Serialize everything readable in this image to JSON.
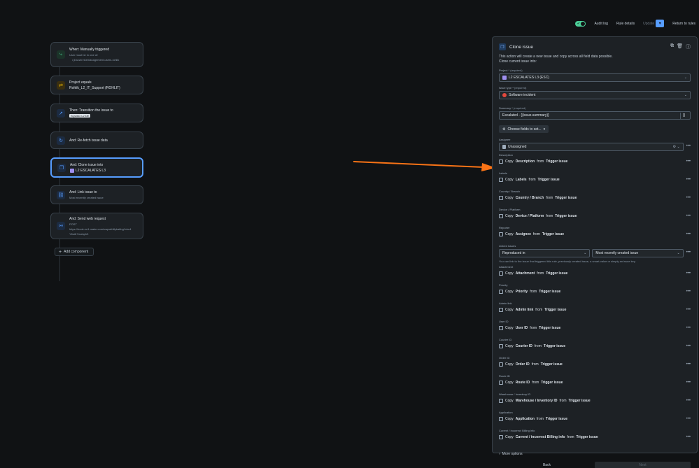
{
  "topbar": {
    "audit_log": "Audit log",
    "rule_details": "Rule details",
    "update": "Update",
    "return": "Return to rules"
  },
  "flow": {
    "nodes": [
      {
        "title": "When: Manually triggered",
        "sub1": "User must be in one of:",
        "sub2": "• jira-servicemanagement-users-rohlik",
        "icon_color": "#4bce97",
        "icon": "trigger-icon"
      },
      {
        "title": "Project equals",
        "sub1": "Rohlik_L2_IT_Support (ROHLIT)",
        "icon_color": "#e2b203",
        "icon": "shuffle-icon"
      },
      {
        "title": "Then: Transition the issue to",
        "tag": "SQUAD L2 DE",
        "icon_color": "#579dff",
        "icon": "transition-icon"
      },
      {
        "title": "And: Re-fetch issue data",
        "icon_color": "#579dff",
        "icon": "refresh-icon"
      },
      {
        "title": "And: Clone issue into",
        "sub1": "L2 ESCALATES L3",
        "icon_color": "#579dff",
        "icon": "clone-icon"
      },
      {
        "title": "And: Link issue to",
        "sub1": "Most recently created issue",
        "icon_color": "#579dff",
        "icon": "link-icon"
      },
      {
        "title": "And: Send web request",
        "sub1": "POST",
        "sub2": "https://hook.eu1.make.com/uwpwth8ybakbg1vku4",
        "sub3": "Y6u8r7mahph3",
        "icon_color": "#579dff",
        "icon": "webhook-icon"
      }
    ],
    "add_component": "Add component"
  },
  "panel": {
    "title": "Clone issue",
    "description": "This action will create a new issue and copy across all field data possible.",
    "description2": "Clone current issue into:",
    "project_label": "Project *",
    "project_req": "(required)",
    "project_value": "L2 ESCALATES L3 (ESC)",
    "issue_type_label": "Issue type *",
    "issue_type_req": "(required)",
    "issue_type_value": "Software incident",
    "summary_label": "Summary *",
    "summary_req": "(required)",
    "summary_value": "Escalated - {{issue.summary}}",
    "choose_fields": "Choose fields to set...",
    "assignee_label": "Assignee",
    "assignee_value": "Unassigned",
    "copy_fields": [
      {
        "label": "Description",
        "pre": "Copy",
        "field": "Description",
        "mid": "from",
        "src": "Trigger issue"
      },
      {
        "label": "Labels",
        "pre": "Copy",
        "field": "Labels",
        "mid": "from",
        "src": "Trigger issue"
      },
      {
        "label": "Country / Branch",
        "pre": "Copy",
        "field": "Country / Branch",
        "mid": "from",
        "src": "Trigger issue"
      },
      {
        "label": "Device / Platform",
        "pre": "Copy",
        "field": "Device / Platform",
        "mid": "from",
        "src": "Trigger issue"
      },
      {
        "label": "Reporter",
        "pre": "Copy",
        "field": "Assignee",
        "mid": "from",
        "src": "Trigger issue"
      }
    ],
    "linked_label": "Linked issues",
    "linked_type": "Reproduced in",
    "linked_target": "Most recently created issue",
    "linked_hint": "You can link to the issue that triggered this rule, previously created issue, a smart-value or simply an issue key.",
    "copy_fields2": [
      {
        "label": "Attachment",
        "pre": "Copy",
        "field": "Attachment",
        "mid": "from",
        "src": "Trigger issue"
      },
      {
        "label": "Priority",
        "pre": "Copy",
        "field": "Priority",
        "mid": "from",
        "src": "Trigger issue"
      },
      {
        "label": "Admin link",
        "pre": "Copy",
        "field": "Admin link",
        "mid": "from",
        "src": "Trigger issue"
      },
      {
        "label": "User ID",
        "pre": "Copy",
        "field": "User ID",
        "mid": "from",
        "src": "Trigger issue"
      },
      {
        "label": "Courier ID",
        "pre": "Copy",
        "field": "Courier ID",
        "mid": "from",
        "src": "Trigger issue"
      },
      {
        "label": "Order ID",
        "pre": "Copy",
        "field": "Order ID",
        "mid": "from",
        "src": "Trigger issue"
      },
      {
        "label": "Route ID",
        "pre": "Copy",
        "field": "Route ID",
        "mid": "from",
        "src": "Trigger issue"
      },
      {
        "label": "Warehouse / Inventory ID",
        "pre": "Copy",
        "field": "Warehouse / Inventory ID",
        "mid": "from",
        "src": "Trigger issue"
      },
      {
        "label": "Application",
        "pre": "Copy",
        "field": "Application",
        "mid": "from",
        "src": "Trigger issue"
      },
      {
        "label": "Current / incorrect Billing info",
        "pre": "Copy",
        "field": "Current / incorrect Billing info",
        "mid": "from",
        "src": "Trigger issue"
      }
    ],
    "more_options": "More options",
    "back": "Back",
    "next": "Next"
  },
  "colors": {
    "accent": "#579dff",
    "arrow": "#f97316",
    "toggle": "#4bce97"
  }
}
